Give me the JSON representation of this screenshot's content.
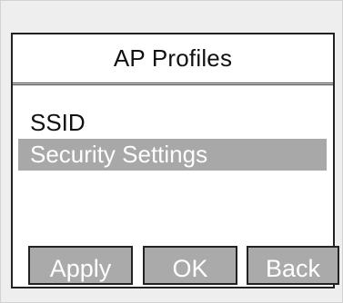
{
  "screen": {
    "title": "AP Profiles"
  },
  "menu": {
    "items": [
      {
        "label": "SSID",
        "selected": false
      },
      {
        "label": "Security Settings",
        "selected": true
      }
    ]
  },
  "softkeys": {
    "apply_label": "Apply",
    "ok_label": "OK",
    "back_label": "Back"
  },
  "colors": {
    "selection_highlight": "#a8a8a8",
    "softkey_fill": "#aaaaaa",
    "border": "#222222",
    "device_background": "#eeeeee"
  }
}
